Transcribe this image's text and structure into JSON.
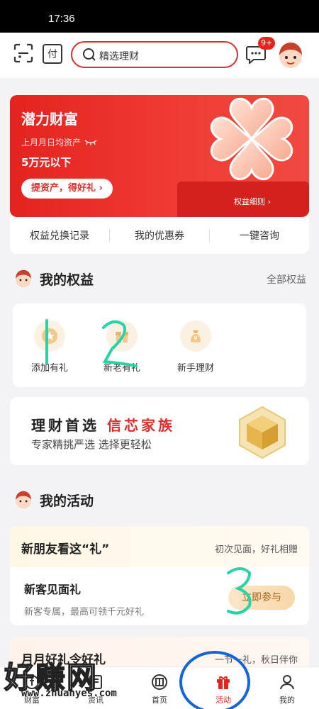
{
  "status_bar": {
    "time": "17:36"
  },
  "top_bar": {
    "pay_label": "付",
    "search_placeholder": "精选理财",
    "message_badge": "9+"
  },
  "hero": {
    "title": "潜力财富",
    "subtitle": "上月月日均资产",
    "amount": "5万元以下",
    "cta": "提资产，得好礼 ›",
    "detail_link": "权益细则 ›",
    "accent": "#e4231f"
  },
  "quick_links": [
    "权益兑换记录",
    "我的优惠券",
    "一键咨询"
  ],
  "my_benefits": {
    "title": "我的权益",
    "more": "全部权益",
    "items": [
      {
        "label": "添加有礼",
        "icon": "gift-icon"
      },
      {
        "label": "新老有礼",
        "icon": "present-icon"
      },
      {
        "label": "新手理财",
        "icon": "money-bag-icon"
      }
    ]
  },
  "promo": {
    "line1_a": "理财首选",
    "line1_b": "信芯家族",
    "line2": "专家精挑严选 选择更轻松"
  },
  "my_activities": {
    "title": "我的活动",
    "card1": {
      "header": "新朋友看这“礼”",
      "header_right": "初次见面，好礼相赠",
      "title": "新客见面礼",
      "desc": "新客专属，最高可领千元好礼",
      "button": "立即参与"
    },
    "card2": {
      "header": "月月好礼令好礼",
      "header_right": "一节一礼，秋日伴你"
    }
  },
  "tab_bar": [
    {
      "label": "财富",
      "icon": "wealth-icon"
    },
    {
      "label": "资讯",
      "icon": "news-icon"
    },
    {
      "label": "首页",
      "icon": "citic-logo-icon"
    },
    {
      "label": "活动",
      "icon": "gift-box-icon",
      "active": true
    },
    {
      "label": "我的",
      "icon": "person-icon"
    }
  ],
  "annotations": {
    "mark1": "1",
    "mark2": "2",
    "mark3": "3"
  },
  "watermark": {
    "text": "好赚网",
    "url": "www.zhuanyes.com"
  }
}
